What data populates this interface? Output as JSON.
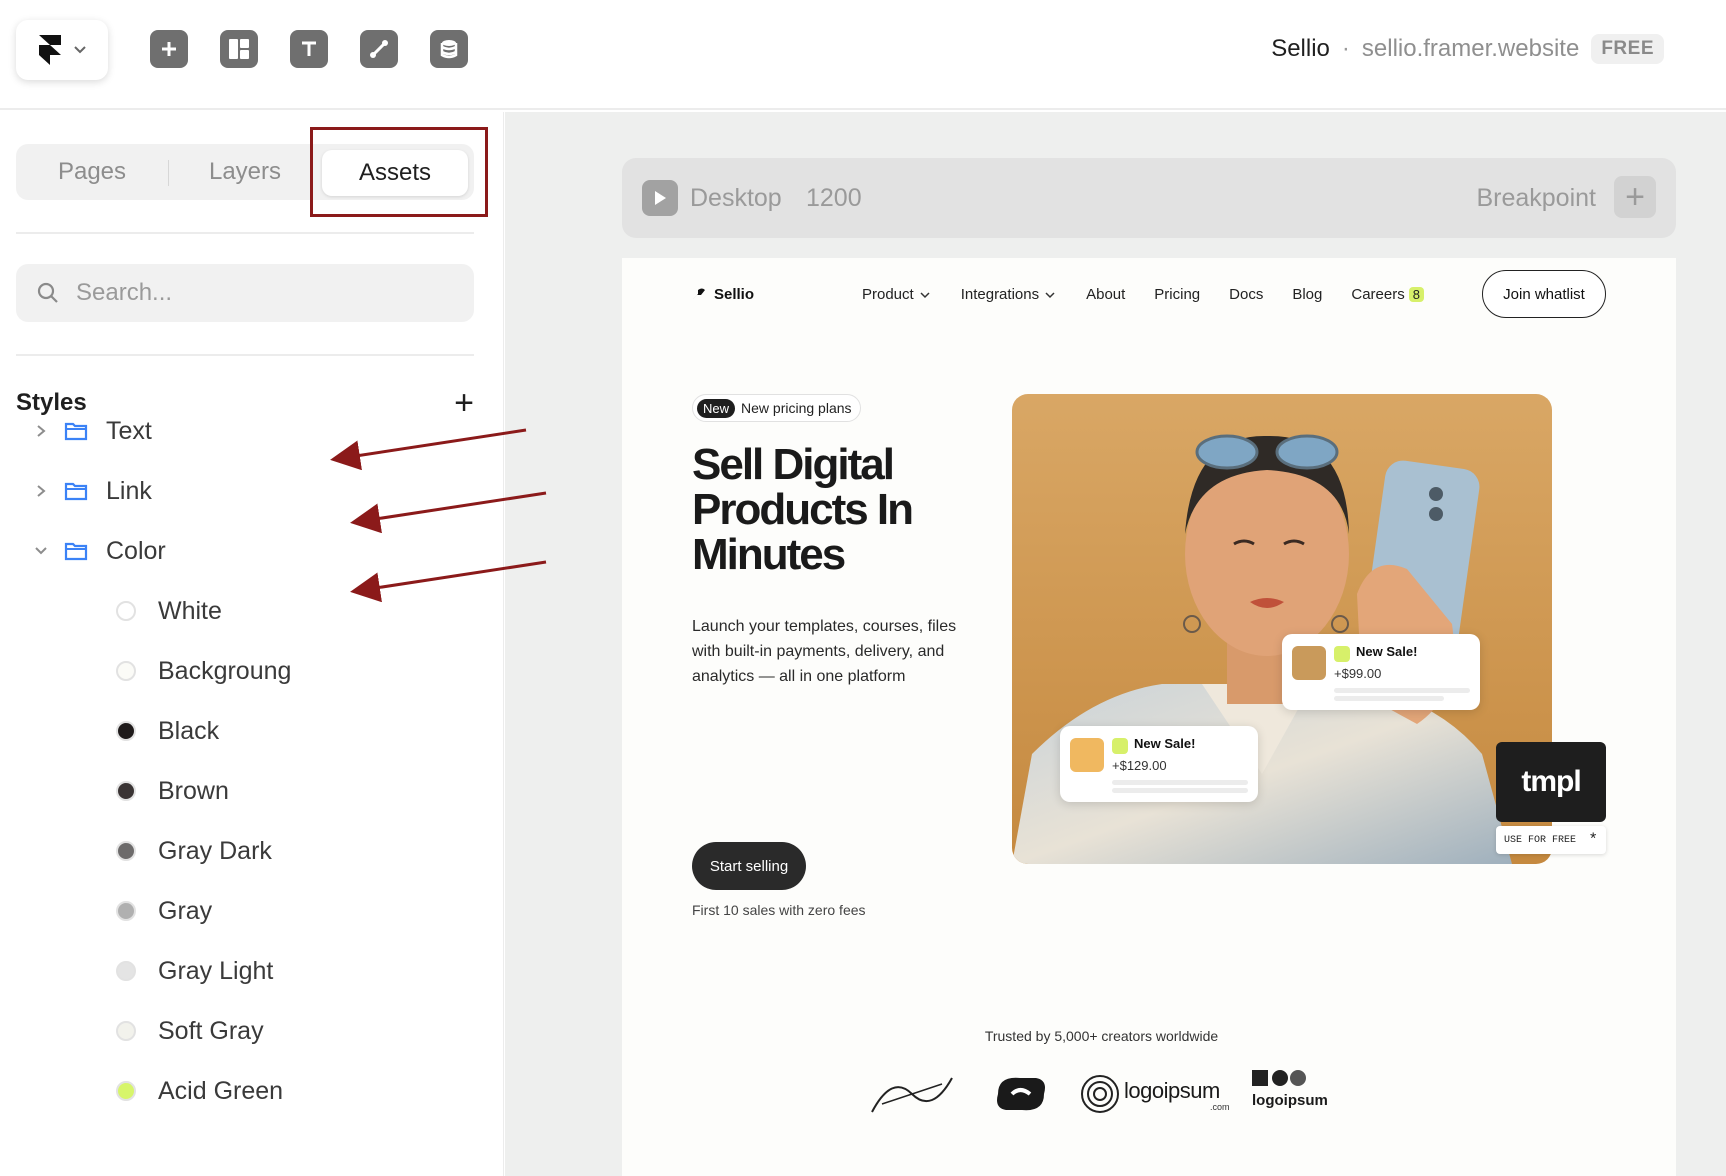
{
  "site": {
    "name": "Sellio",
    "separator": "·",
    "url": "sellio.framer.website",
    "plan_badge": "FREE"
  },
  "toolbar": {
    "tools": [
      "insert-icon",
      "layout-icon",
      "text-icon",
      "vector-icon",
      "cms-icon"
    ]
  },
  "panel": {
    "tabs": [
      {
        "label": "Pages"
      },
      {
        "label": "Layers"
      },
      {
        "label": "Assets"
      }
    ],
    "active_tab": "Assets",
    "search_placeholder": "Search...",
    "styles_title": "Styles",
    "add_symbol": "+",
    "folders": [
      {
        "label": "Text",
        "expanded": false
      },
      {
        "label": "Link",
        "expanded": false
      },
      {
        "label": "Color",
        "expanded": true
      }
    ],
    "colors": [
      {
        "label": "White",
        "hex": "#ffffff"
      },
      {
        "label": "Backgroung",
        "hex": "#fbfbf7"
      },
      {
        "label": "Black",
        "hex": "#1f1b1b"
      },
      {
        "label": "Brown",
        "hex": "#3a3434"
      },
      {
        "label": "Gray Dark",
        "hex": "#6d6b6b"
      },
      {
        "label": "Gray",
        "hex": "#b0b0b0"
      },
      {
        "label": "Gray Light",
        "hex": "#e4e4e4"
      },
      {
        "label": "Soft Gray",
        "hex": "#f2f2ec"
      },
      {
        "label": "Acid Green",
        "hex": "#d7f56b"
      }
    ],
    "annotation_color": "#8b1a1a"
  },
  "breakpoint_bar": {
    "device": "Desktop",
    "width": "1200",
    "label": "Breakpoint",
    "add_symbol": "+"
  },
  "preview": {
    "brand": "Sellio",
    "nav": [
      {
        "label": "Product",
        "dropdown": true
      },
      {
        "label": "Integrations",
        "dropdown": true
      },
      {
        "label": "About"
      },
      {
        "label": "Pricing"
      },
      {
        "label": "Docs"
      },
      {
        "label": "Blog"
      },
      {
        "label": "Careers",
        "badge": "8"
      }
    ],
    "join_label": "Join whatlist",
    "pill_new": "New",
    "pill_text": "New pricing plans",
    "headline": "Sell Digital Products In Minutes",
    "lede": "Launch your templates, courses, files with built-in payments, delivery, and analytics — all in one platform",
    "cta": "Start selling",
    "cta_note": "First 10 sales with zero fees",
    "sale_cards": [
      {
        "title": "New Sale!",
        "amount": "+$99.00"
      },
      {
        "title": "New Sale!",
        "amount": "+$129.00"
      }
    ],
    "tmpl_logo": "tmpl",
    "tmpl_free": "USE FOR FREE",
    "tmpl_star": "*",
    "trusted": "Trusted by 5,000+ creators worldwide",
    "logos": [
      "logoipsum",
      "logoipsum"
    ],
    "logo_sub": ".com",
    "accent": "#d7f06a"
  }
}
